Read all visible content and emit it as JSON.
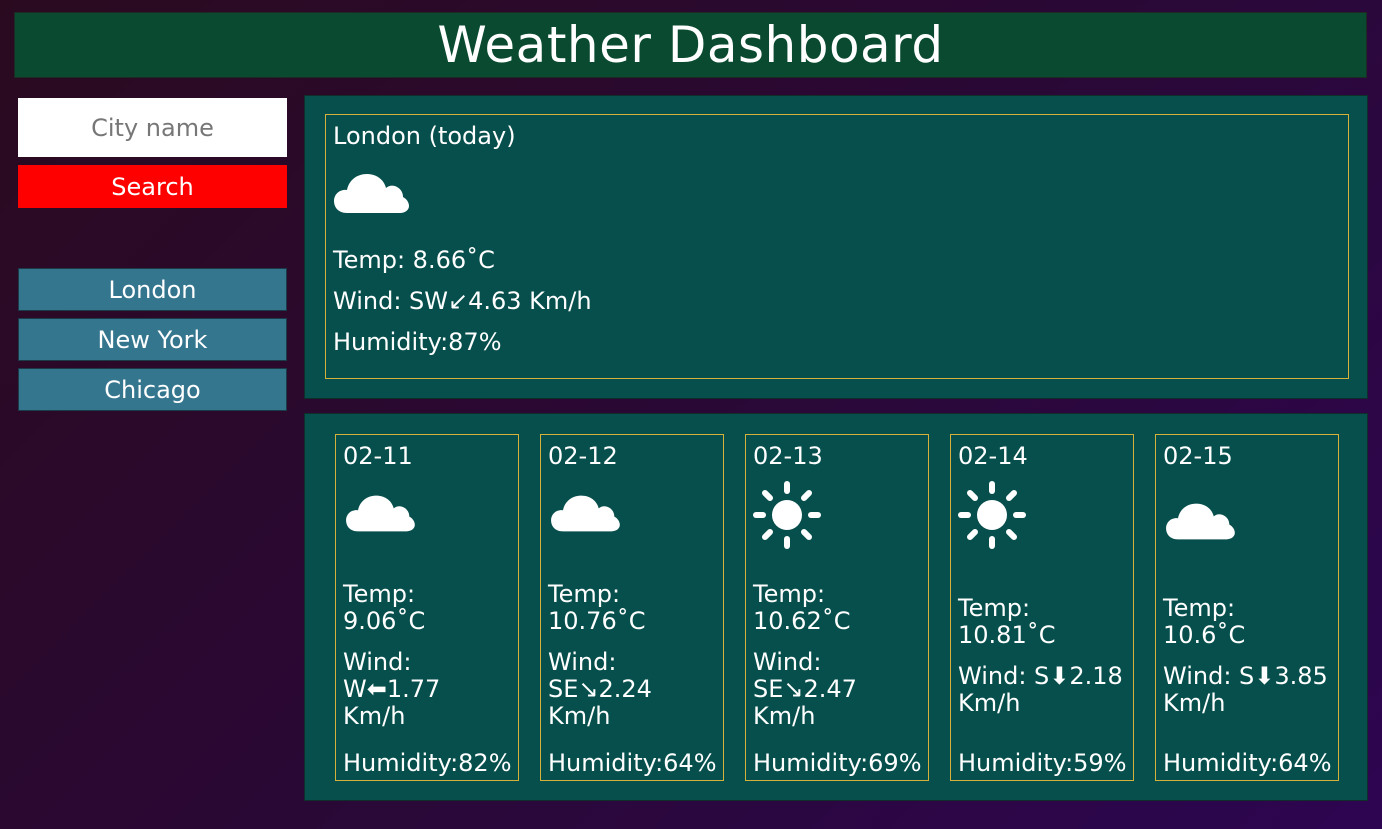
{
  "header": {
    "title": "Weather Dashboard"
  },
  "search": {
    "placeholder": "City name",
    "value": "",
    "button_label": "Search"
  },
  "history": [
    {
      "label": "London"
    },
    {
      "label": "New York"
    },
    {
      "label": "Chicago"
    }
  ],
  "today": {
    "title": "London (today)",
    "icon": "cloud-icon",
    "temp": "Temp: 8.66˚C",
    "wind": "Wind: SW↙4.63 Km/h",
    "humidity": "Humidity:87%"
  },
  "forecast": [
    {
      "date": "02-11",
      "icon": "cloud-icon",
      "temp_label": "Temp:",
      "temp": "9.06˚C",
      "wind_label": "Wind:",
      "wind": "W⬅1.77",
      "wind_unit": "Km/h",
      "humidity": "Humidity:82%"
    },
    {
      "date": "02-12",
      "icon": "cloud-icon",
      "temp_label": "Temp:",
      "temp": "10.76˚C",
      "wind_label": "Wind:",
      "wind": "SE↘2.24",
      "wind_unit": "Km/h",
      "humidity": "Humidity:64%"
    },
    {
      "date": "02-13",
      "icon": "sun-icon",
      "temp_label": "Temp:",
      "temp": "10.62˚C",
      "wind_label": "Wind:",
      "wind": "SE↘2.47",
      "wind_unit": "Km/h",
      "humidity": "Humidity:69%"
    },
    {
      "date": "02-14",
      "icon": "sun-icon",
      "temp_label": "Temp:",
      "temp": "10.81˚C",
      "wind_label": "Wind: S⬇2.18",
      "wind": "",
      "wind_unit": "Km/h",
      "humidity": "Humidity:59%"
    },
    {
      "date": "02-15",
      "icon": "cloud-icon",
      "temp_label": "Temp:",
      "temp": "10.6˚C",
      "wind_label": "Wind: S⬇3.85",
      "wind": "",
      "wind_unit": "Km/h",
      "humidity": "Humidity:64%"
    }
  ],
  "colors": {
    "header_bg": "#0a4a30",
    "panel_bg": "#074f4c",
    "card_border": "#d4b23a",
    "search_button": "#ff0000",
    "history_button": "#35768f"
  }
}
